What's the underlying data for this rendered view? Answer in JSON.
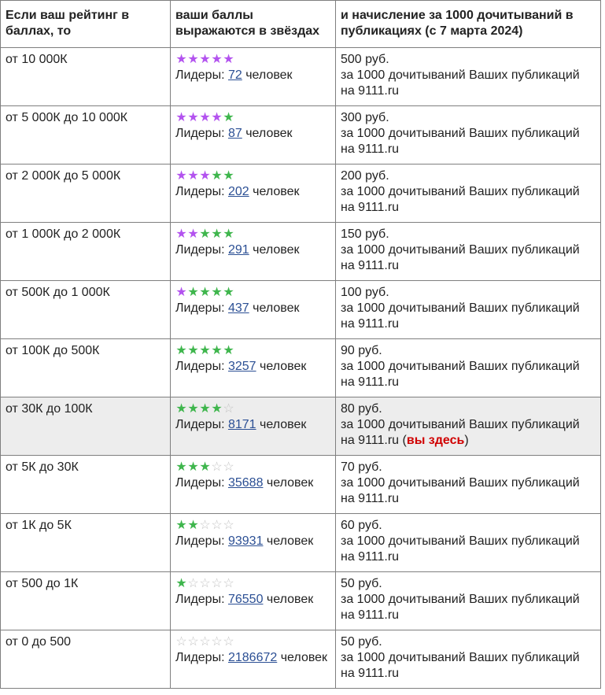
{
  "header": {
    "col1": "Если ваш рейтинг в баллах, то",
    "col2": "ваши баллы выражаются в звёздах",
    "col3": "и начисление за 1000 дочитываний в публикациях (с 7 марта 2024)"
  },
  "labels": {
    "leaders": "Лидеры:",
    "people": "человек",
    "reward_suffix": "за 1000 дочитываний Ваших публикаций на 9111.ru",
    "you_here": "вы здесь"
  },
  "colors": {
    "purple_star": "#b353ef",
    "green_star": "#3fb64d",
    "empty_star": "#c4c4c4",
    "highlight": "#ededed",
    "link": "#2b4f94",
    "here": "#d00000"
  },
  "rows": [
    {
      "range": "от 10 000К",
      "stars": [
        "purple",
        "purple",
        "purple",
        "purple",
        "purple"
      ],
      "leaders": "72",
      "price": "500 руб."
    },
    {
      "range": "от 5 000К до 10 000К",
      "stars": [
        "purple",
        "purple",
        "purple",
        "purple",
        "green"
      ],
      "leaders": "87",
      "price": "300 руб."
    },
    {
      "range": "от 2 000К до 5 000К",
      "stars": [
        "purple",
        "purple",
        "purple",
        "green",
        "green"
      ],
      "leaders": "202",
      "price": "200 руб."
    },
    {
      "range": "от 1 000К до 2 000К",
      "stars": [
        "purple",
        "purple",
        "green",
        "green",
        "green"
      ],
      "leaders": "291",
      "price": "150 руб."
    },
    {
      "range": "от 500К до 1 000К",
      "stars": [
        "purple",
        "green",
        "green",
        "green",
        "green"
      ],
      "leaders": "437",
      "price": "100 руб."
    },
    {
      "range": "от 100К до 500К",
      "stars": [
        "green",
        "green",
        "green",
        "green",
        "green"
      ],
      "leaders": "3257",
      "price": "90 руб."
    },
    {
      "range": "от 30К до 100К",
      "stars": [
        "green",
        "green",
        "green",
        "green",
        "empty"
      ],
      "leaders": "8171",
      "price": "80 руб.",
      "current": true
    },
    {
      "range": "от 5К до 30К",
      "stars": [
        "green",
        "green",
        "green",
        "empty",
        "empty"
      ],
      "leaders": "35688",
      "price": "70 руб."
    },
    {
      "range": "от 1К до 5К",
      "stars": [
        "green",
        "green",
        "empty",
        "empty",
        "empty"
      ],
      "leaders": "93931",
      "price": "60 руб."
    },
    {
      "range": "от 500 до 1К",
      "stars": [
        "green",
        "empty",
        "empty",
        "empty",
        "empty"
      ],
      "leaders": "76550",
      "price": "50 руб."
    },
    {
      "range": "от 0 до 500",
      "stars": [
        "empty",
        "empty",
        "empty",
        "empty",
        "empty"
      ],
      "leaders": "2186672",
      "price": "50 руб."
    }
  ]
}
